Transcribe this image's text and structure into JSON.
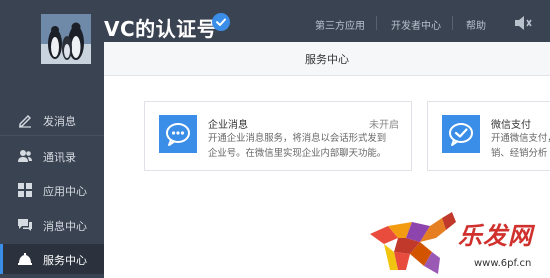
{
  "account": {
    "name": "VC的认证号"
  },
  "top_nav": [
    {
      "label": "第三方应用"
    },
    {
      "label": "开发者中心"
    },
    {
      "label": "帮助"
    }
  ],
  "sidebar": {
    "items": [
      {
        "label": "发消息",
        "icon": "edit-icon"
      },
      {
        "label": "通讯录",
        "icon": "contacts-icon"
      },
      {
        "label": "应用中心",
        "icon": "apps-icon"
      },
      {
        "label": "消息中心",
        "icon": "message-icon"
      },
      {
        "label": "服务中心",
        "icon": "service-bell-icon"
      }
    ],
    "active_index": 4
  },
  "main": {
    "title": "服务中心",
    "cards": [
      {
        "title": "企业消息",
        "status": "未开启",
        "desc_line1": "开通企业消息服务，将消息以会话形式发到",
        "desc_line2": "企业号。在微信里实现企业内部聊天功能。",
        "icon": "chat-bubble-icon"
      },
      {
        "title": "微信支付",
        "status": "",
        "desc_line1": "开通微信支付，是份",
        "desc_line2": "销、经销分析",
        "icon": "checkmark-bubble-icon"
      }
    ]
  },
  "watermark": {
    "text": "乐发网",
    "url": "www.6pf.cn"
  },
  "colors": {
    "sidebar_bg": "#3a4352",
    "accent": "#3b8ee8",
    "watermark_red": "#d0312d"
  }
}
